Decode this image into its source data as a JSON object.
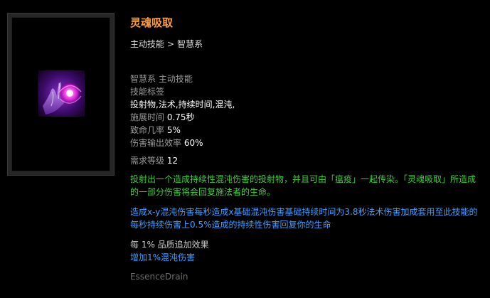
{
  "skill": {
    "title": "灵魂吸取",
    "breadcrumb": {
      "parent": "主动技能",
      "separator": ">",
      "child": "智慧系"
    },
    "icon": "soul-drain-hand-icon"
  },
  "stats": {
    "type_line": "智慧系 主动技能",
    "tags_label": "技能标签",
    "tags": "投射物,法术,持续时间,混沌,",
    "cast_time": {
      "label": "施展时间",
      "value": "0.75秒"
    },
    "crit_chance": {
      "label": "致命几率",
      "value": "5%"
    },
    "damage_effectiveness": {
      "label": "伤害输出效率",
      "value": "60%"
    },
    "required_level": {
      "label": "需求等级",
      "value": "12"
    }
  },
  "description": {
    "main": "投射出一个造成持续性混沌伤害的投射物，并且可由「瘟疫」一起传染。「灵魂吸取」所造成的一部分伤害将会回复施法者的生命。",
    "mods": "造成x-y混沌伤害每秒造成x基础混沌伤害基础持续时间为3.8秒法术伤害加成套用至此技能的每秒持续伤害上0.5%造成的持续性伤害回复你的生命"
  },
  "quality": {
    "header": "每 1% 品质追加效果",
    "bonus": "增加1%混沌伤害"
  },
  "internal_name": "EssenceDrain",
  "colors": {
    "title": "#ff9d3b",
    "description": "#3ecf3e",
    "mods": "#3fa0ff",
    "label": "#9a9a9a",
    "value": "#ffffff"
  }
}
